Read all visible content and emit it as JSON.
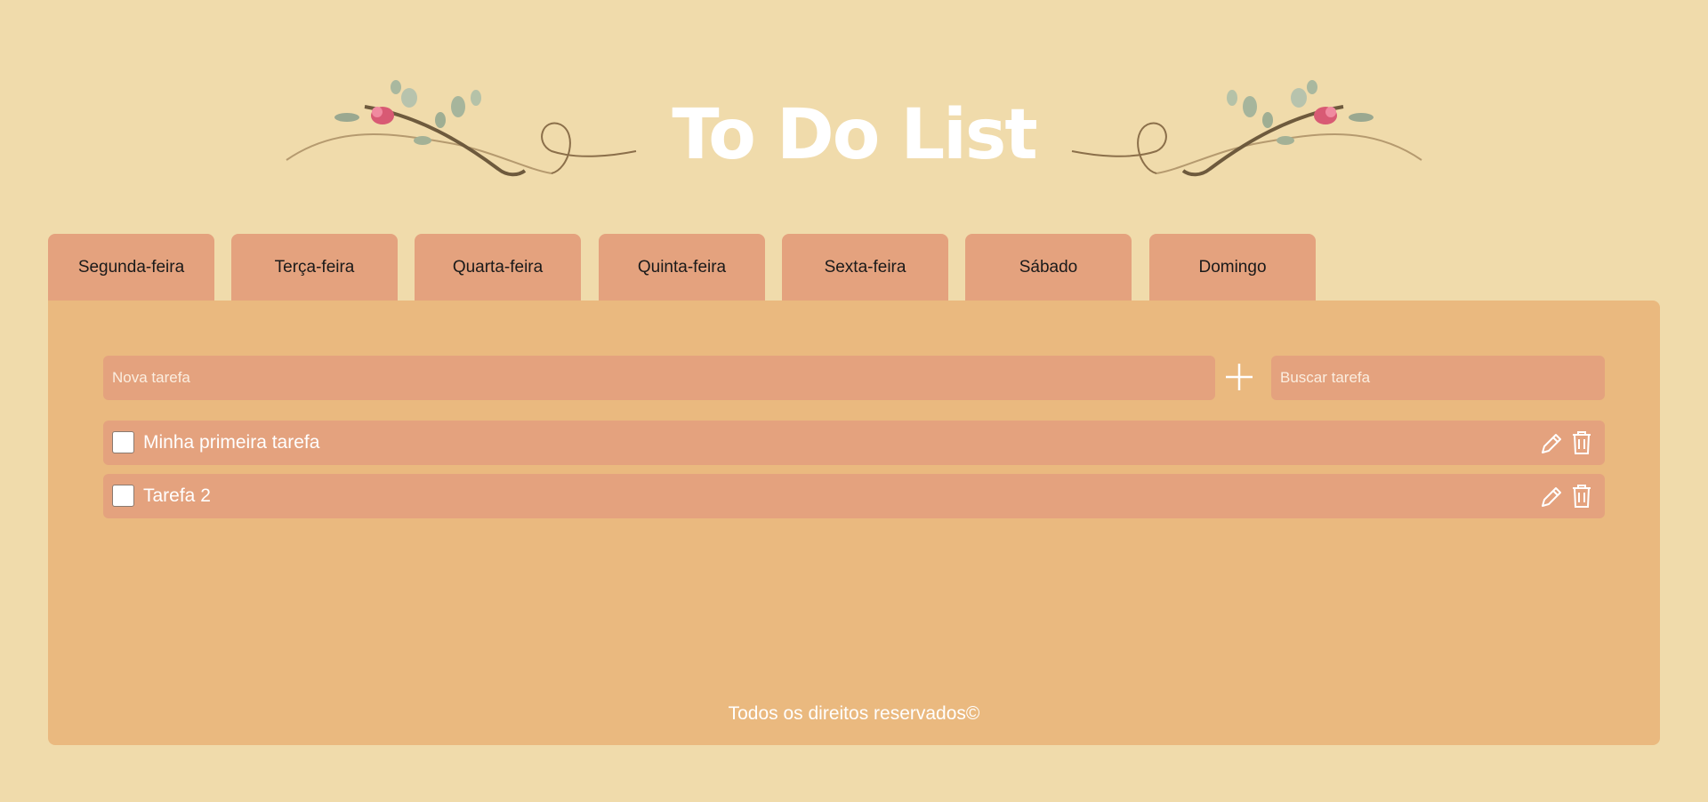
{
  "header": {
    "title": "To Do List"
  },
  "tabs": [
    {
      "label": "Segunda-feira"
    },
    {
      "label": "Terça-feira"
    },
    {
      "label": "Quarta-feira"
    },
    {
      "label": "Quinta-feira"
    },
    {
      "label": "Sexta-feira"
    },
    {
      "label": "Sábado"
    },
    {
      "label": "Domingo"
    }
  ],
  "new_task": {
    "placeholder": "Nova tarefa",
    "value": ""
  },
  "add_button": {
    "icon": "plus-icon"
  },
  "search": {
    "placeholder": "Buscar tarefa",
    "value": ""
  },
  "tasks": [
    {
      "label": "Minha primeira tarefa",
      "checked": false
    },
    {
      "label": "Tarefa 2",
      "checked": false
    }
  ],
  "task_actions": {
    "edit_icon": "pencil-icon",
    "delete_icon": "trash-icon"
  },
  "footer": {
    "text": "Todos os direitos reservados©"
  },
  "colors": {
    "background": "#f0dbab",
    "panel": "#eab97f",
    "tab": "#e4a27e",
    "field": "#e4a27e",
    "title": "#ffffff"
  }
}
